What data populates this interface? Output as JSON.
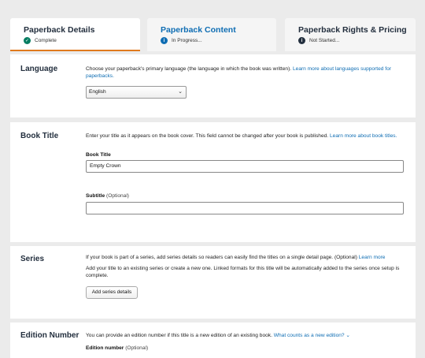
{
  "tabs": [
    {
      "title": "Paperback Details",
      "status": "Complete",
      "status_icon": "check-circle-icon"
    },
    {
      "title": "Paperback Content",
      "status": "In Progress...",
      "status_icon": "info-icon"
    },
    {
      "title": "Paperback Rights & Pricing",
      "status": "Not Started...",
      "status_icon": "info-icon"
    }
  ],
  "language": {
    "title": "Language",
    "description": "Choose your paperback's primary language (the language in which the book was written).",
    "link": "Learn more about languages supported for paperbacks.",
    "selected": "English"
  },
  "book_title": {
    "title": "Book Title",
    "description": "Enter your title as it appears on the book cover. This field cannot be changed after your book is published.",
    "link": "Learn more about book titles.",
    "title_label": "Book Title",
    "title_value": "Empty Crown",
    "subtitle_label": "Subtitle",
    "subtitle_optional": "(Optional)",
    "subtitle_value": ""
  },
  "series": {
    "title": "Series",
    "description": "If your book is part of a series, add series details so readers can easily find the titles on a single detail page. (Optional)",
    "link": "Learn more",
    "description2": "Add your title to an existing series or create a new one. Linked formats for this title will be automatically added to the series once setup is complete.",
    "button": "Add series details"
  },
  "edition": {
    "title": "Edition Number",
    "description": "You can provide an edition number if this title is a new edition of an existing book.",
    "link": "What counts as a new edition?",
    "field_label": "Edition number",
    "field_optional": "(Optional)"
  },
  "colors": {
    "accent": "#e07a1d",
    "link": "#0e6db3",
    "heading": "#232f3e",
    "success": "#067d62"
  }
}
